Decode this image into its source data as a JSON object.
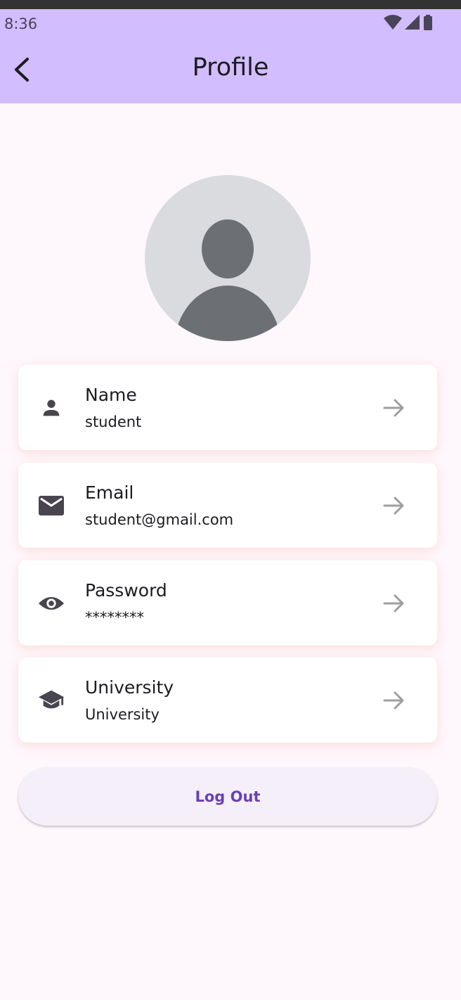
{
  "status_bar": {
    "time": "8:36",
    "icons": [
      "wifi-icon",
      "cell-signal-icon",
      "battery-icon"
    ]
  },
  "app_bar": {
    "title": "Profile",
    "back_icon": "chevron-left-icon",
    "background": "#d2bdfe"
  },
  "avatar": {
    "icon": "person-silhouette"
  },
  "fields": [
    {
      "icon": "person-icon",
      "label": "Name",
      "value": "student"
    },
    {
      "icon": "email-icon",
      "label": "Email",
      "value": "student@gmail.com"
    },
    {
      "icon": "eye-icon",
      "label": "Password",
      "value": "********"
    },
    {
      "icon": "school-icon",
      "label": "University",
      "value": "University"
    }
  ],
  "logout": {
    "label": "Log Out",
    "color": "#6b3fb7"
  },
  "colors": {
    "page_background": "#fef7fc",
    "card_background": "#ffffff",
    "icon": "#49454f",
    "arrow": "#9e9e9e"
  }
}
